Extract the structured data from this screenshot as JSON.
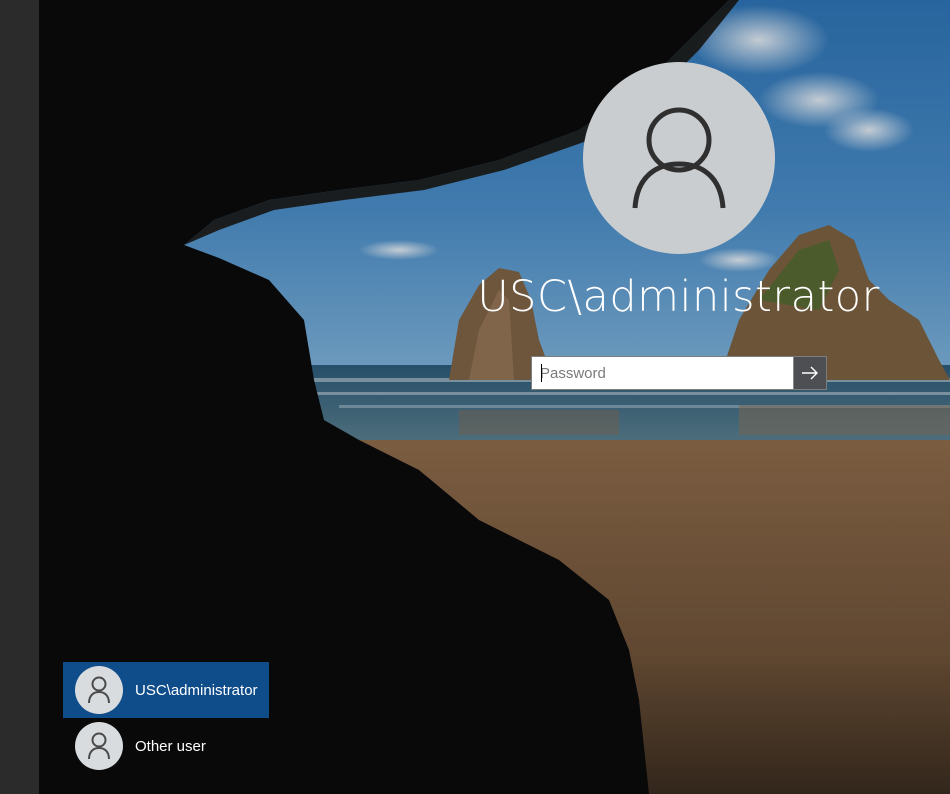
{
  "login": {
    "display_name": "USC\\administrator",
    "password_placeholder": "Password"
  },
  "icons": {
    "avatar": "user-silhouette-icon",
    "submit": "arrow-right-icon"
  },
  "user_list": [
    {
      "label": "USC\\administrator",
      "selected": true
    },
    {
      "label": "Other user",
      "selected": false
    }
  ],
  "colors": {
    "selected_tile": "#0f4c8a",
    "avatar_circle": "#c9cdd0"
  }
}
